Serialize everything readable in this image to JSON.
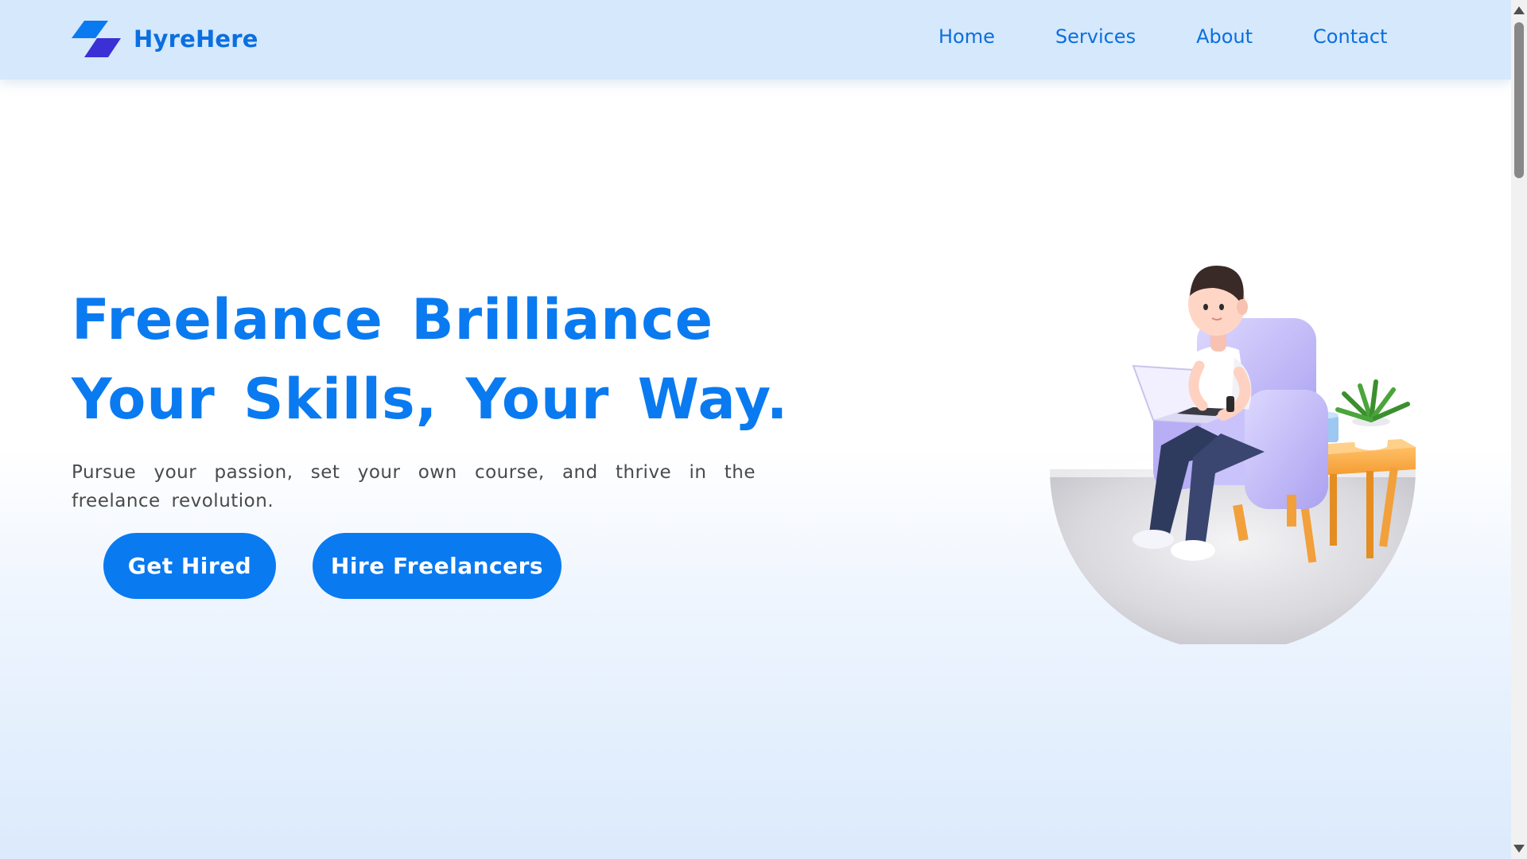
{
  "brand": {
    "name": "HyreHere",
    "icon": "parallelogram-logo-icon"
  },
  "nav": {
    "items": [
      {
        "label": "Home"
      },
      {
        "label": "Services"
      },
      {
        "label": "About"
      },
      {
        "label": "Contact"
      }
    ]
  },
  "hero": {
    "title_line1": "Freelance Brilliance",
    "title_line2": "Your Skills, Your Way.",
    "description": "Pursue your passion, set your own course, and thrive in the freelance revolution.",
    "buttons": {
      "get_hired": "Get Hired",
      "hire_freelancers": "Hire Freelancers"
    }
  },
  "illustration": {
    "icon": "man-on-armchair-with-laptop-illustration"
  },
  "colors": {
    "accent": "#0a7af0",
    "nav_background": "#d6e8fb",
    "logo_dark": "#3b2fd6"
  }
}
